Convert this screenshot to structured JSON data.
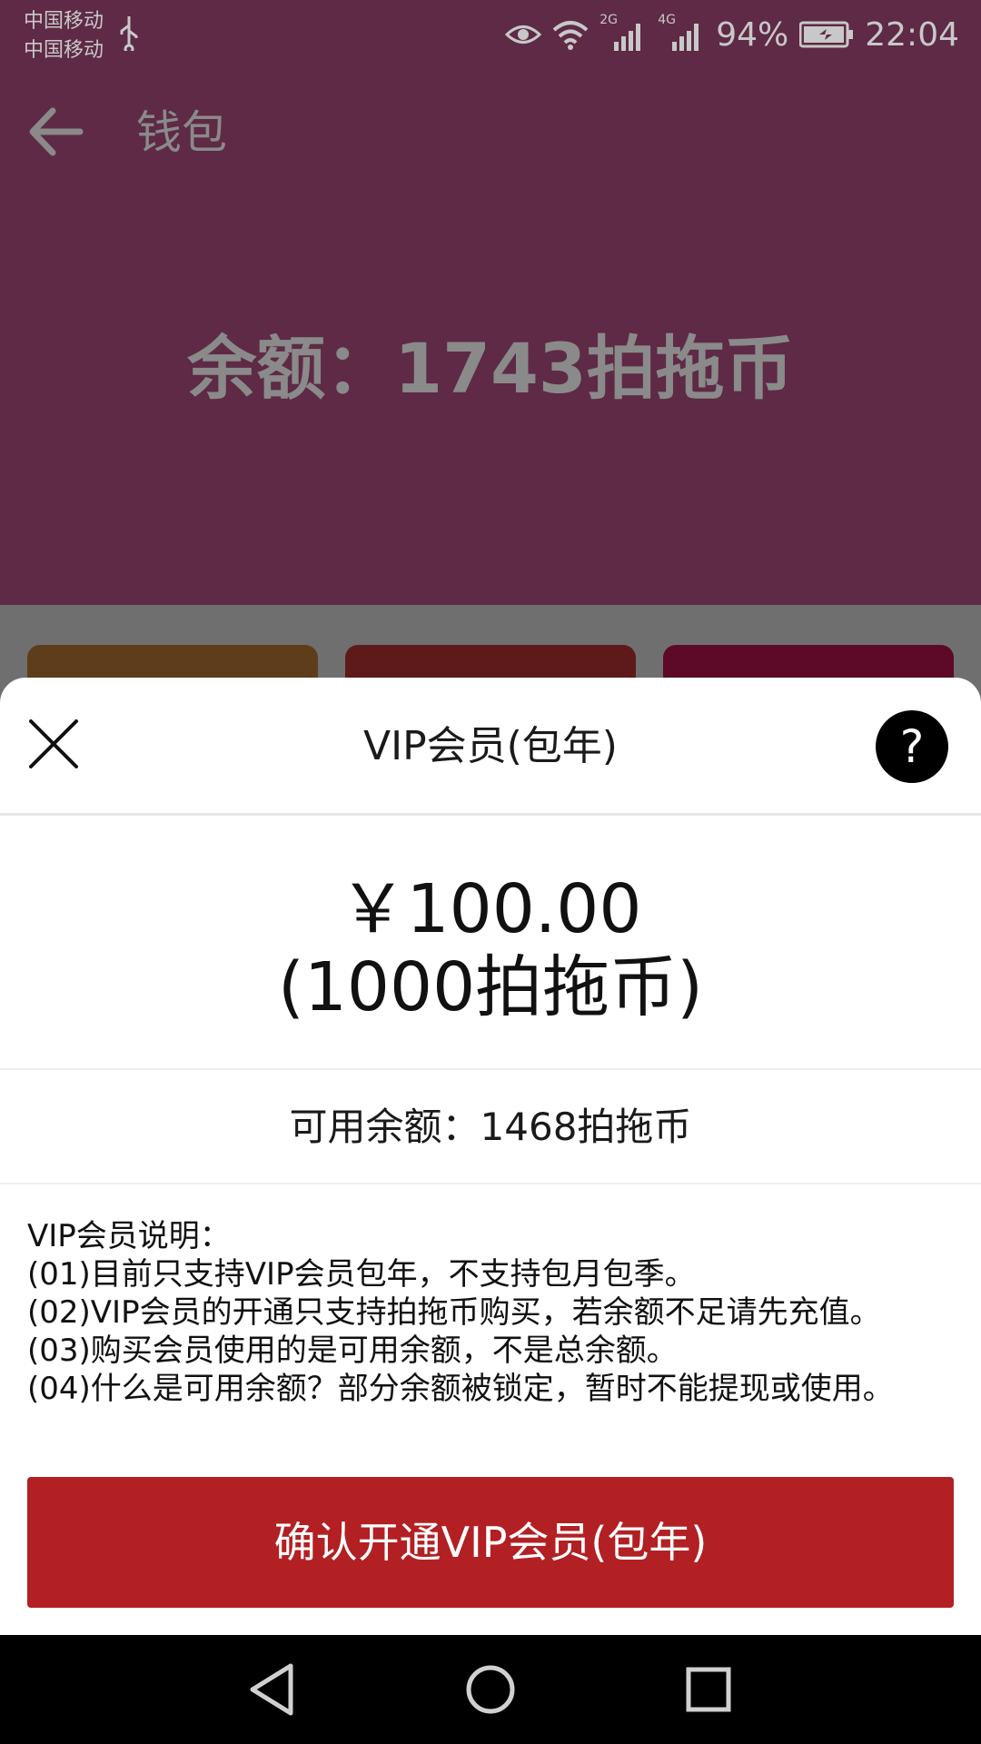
{
  "status_bar": {
    "carrier_1": "中国移动",
    "carrier_2": "中国移动",
    "network_2g": "2G",
    "network_4g": "4G",
    "battery": "94%",
    "time": "22:04"
  },
  "header": {
    "title": "钱包"
  },
  "balance": {
    "text": "余额：1743拍拖币"
  },
  "sheet": {
    "title": "VIP会员(包年)",
    "help_label": "?",
    "price": "￥100.00",
    "coins": "(1000拍拖币)",
    "available": "可用余额：1468拍拖币",
    "notes": {
      "heading": "VIP会员说明：",
      "items": [
        "(01)目前只支持VIP会员包年，不支持包月包季。",
        "(02)VIP会员的开通只支持拍拖币购买，若余额不足请先充值。",
        "(03)购买会员使用的是可用余额，不是总余额。",
        "(04)什么是可用余额？部分余额被锁定，暂时不能提现或使用。"
      ]
    },
    "confirm_label": "确认开通VIP会员(包年)"
  },
  "colors": {
    "header_bg": "#5e2a45",
    "confirm_bg": "#b22024",
    "tile_1": "#5e3d1a",
    "tile_2": "#5e1a1a",
    "tile_3": "#5c0a28"
  },
  "icons": [
    "usb-icon",
    "eye-icon",
    "wifi-icon",
    "signal-icon",
    "battery-icon",
    "back-arrow-icon",
    "close-icon",
    "help-icon",
    "nav-back-icon",
    "nav-home-icon",
    "nav-recents-icon"
  ]
}
